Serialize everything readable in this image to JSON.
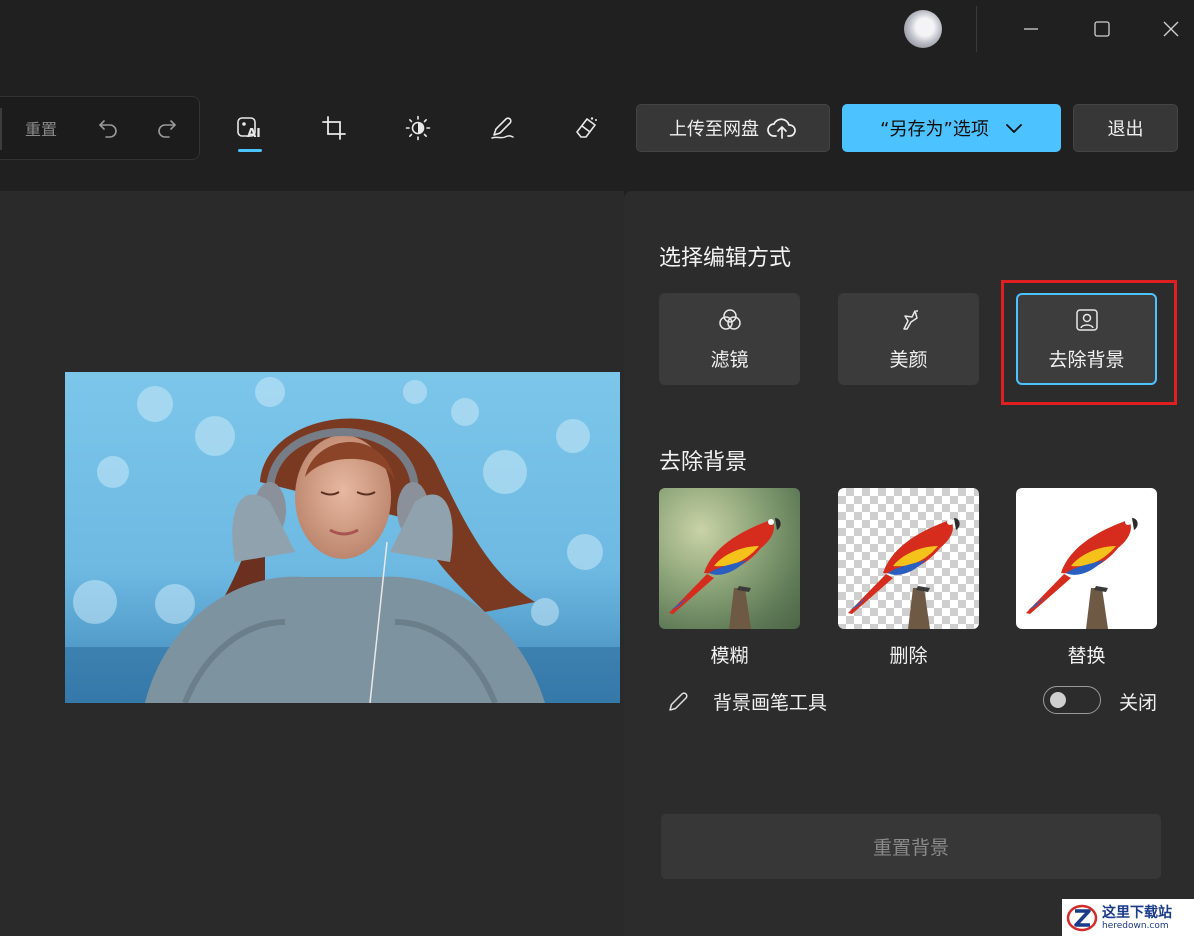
{
  "titlebar": {
    "avatar_icon": "user-avatar",
    "minimize_icon": "minimize-icon",
    "maximize_icon": "maximize-icon",
    "close_icon": "close-icon"
  },
  "toolbar": {
    "reset_label": "重置",
    "undo_icon": "undo-icon",
    "redo_icon": "redo-icon",
    "tools": [
      {
        "name": "ai-image-icon",
        "active": true
      },
      {
        "name": "crop-icon",
        "active": false
      },
      {
        "name": "brightness-icon",
        "active": false
      },
      {
        "name": "markup-pen-icon",
        "active": false
      },
      {
        "name": "eraser-icon",
        "active": false
      }
    ],
    "upload_label": "上传至网盘",
    "saveas_label": "“另存为”选项",
    "exit_label": "退出",
    "accent_color": "#4cc2ff"
  },
  "panel": {
    "edit_mode_title": "选择编辑方式",
    "modes": [
      {
        "label": "滤镜",
        "icon": "filter-icon"
      },
      {
        "label": "美颜",
        "icon": "retouch-icon"
      },
      {
        "label": "去除背景",
        "icon": "person-portrait-icon",
        "selected": true
      }
    ],
    "bg_title": "去除背景",
    "bg_options": [
      {
        "label": "模糊"
      },
      {
        "label": "删除"
      },
      {
        "label": "替换"
      }
    ],
    "brush_label": "背景画笔工具",
    "brush_toggle_text": "关闭",
    "brush_toggle_on": false,
    "reset_bg_label": "重置背景"
  },
  "watermark": {
    "logo_title": "这里下载站",
    "logo_url_text": "heredown.com"
  }
}
